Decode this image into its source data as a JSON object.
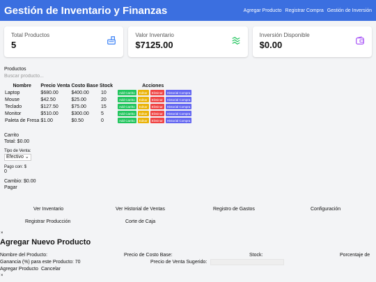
{
  "header": {
    "title": "Gestión de Inventario y Finanzas",
    "nav": [
      "Agregar Producto",
      "Registrar Compra",
      "Gestión de Inversión"
    ]
  },
  "summary": [
    {
      "label": "Total Productos",
      "value": "5",
      "icon": "cash-register-icon",
      "color": "#3b82f6"
    },
    {
      "label": "Valor Inventario",
      "value": "$7125.00",
      "icon": "money-wave-icon",
      "color": "#22c55e"
    },
    {
      "label": "Inversión Disponible",
      "value": "$0.00",
      "icon": "wallet-icon",
      "color": "#a855f7"
    }
  ],
  "products": {
    "section_label": "Productos",
    "search_placeholder": "Buscar producto...",
    "columns": [
      "Nombre",
      "Precio Venta",
      "Costo Base",
      "Stock",
      "Acciones"
    ],
    "rows": [
      {
        "name": "Laptop",
        "price": "$680.00",
        "cost": "$400.00",
        "stock": "10"
      },
      {
        "name": "Mouse",
        "price": "$42.50",
        "cost": "$25.00",
        "stock": "20"
      },
      {
        "name": "Teclado",
        "price": "$127.50",
        "cost": "$75.00",
        "stock": "15"
      },
      {
        "name": "Monitor",
        "price": "$510.00",
        "cost": "$300.00",
        "stock": "5"
      },
      {
        "name": "Paleta de Fresa",
        "price": "$1.00",
        "cost": "$0.50",
        "stock": "0"
      }
    ],
    "actions": {
      "add_cart": "Add Carrito",
      "edit": "Editar",
      "delete": "Eliminar",
      "history": "Historial Compra"
    }
  },
  "cart": {
    "title": "Carrito",
    "total": "Total: $0.00",
    "sale_type_label": "Tipo de Venta:",
    "sale_type_value": "Efectivo",
    "pay_with_label": "Pago con: $",
    "pay_with_value": "0",
    "change": "Cambio: $0.00",
    "pay_button": "Pagar"
  },
  "nav_buttons": {
    "inventory": "Ver Inventario",
    "sales_history": "Ver Historial de Ventas",
    "expenses": "Registro de Gastos",
    "settings": "Configuración",
    "production": "Registrar Producción",
    "cash_cut": "Corte de Caja"
  },
  "add_form": {
    "close": "×",
    "title": "Agregar Nuevo Producto",
    "name_label": "Nombre del Producto:",
    "cost_label": "Precio de Costo Base:",
    "stock_label": "Stock:",
    "pct_label": "Porcentaje de",
    "profit_label": "Ganancia (%) para este Producto: 70",
    "suggested_label": "Precio de Venta Sugerido:",
    "submit": "Agregar Producto",
    "cancel": "Cancelar",
    "close2": "×"
  }
}
